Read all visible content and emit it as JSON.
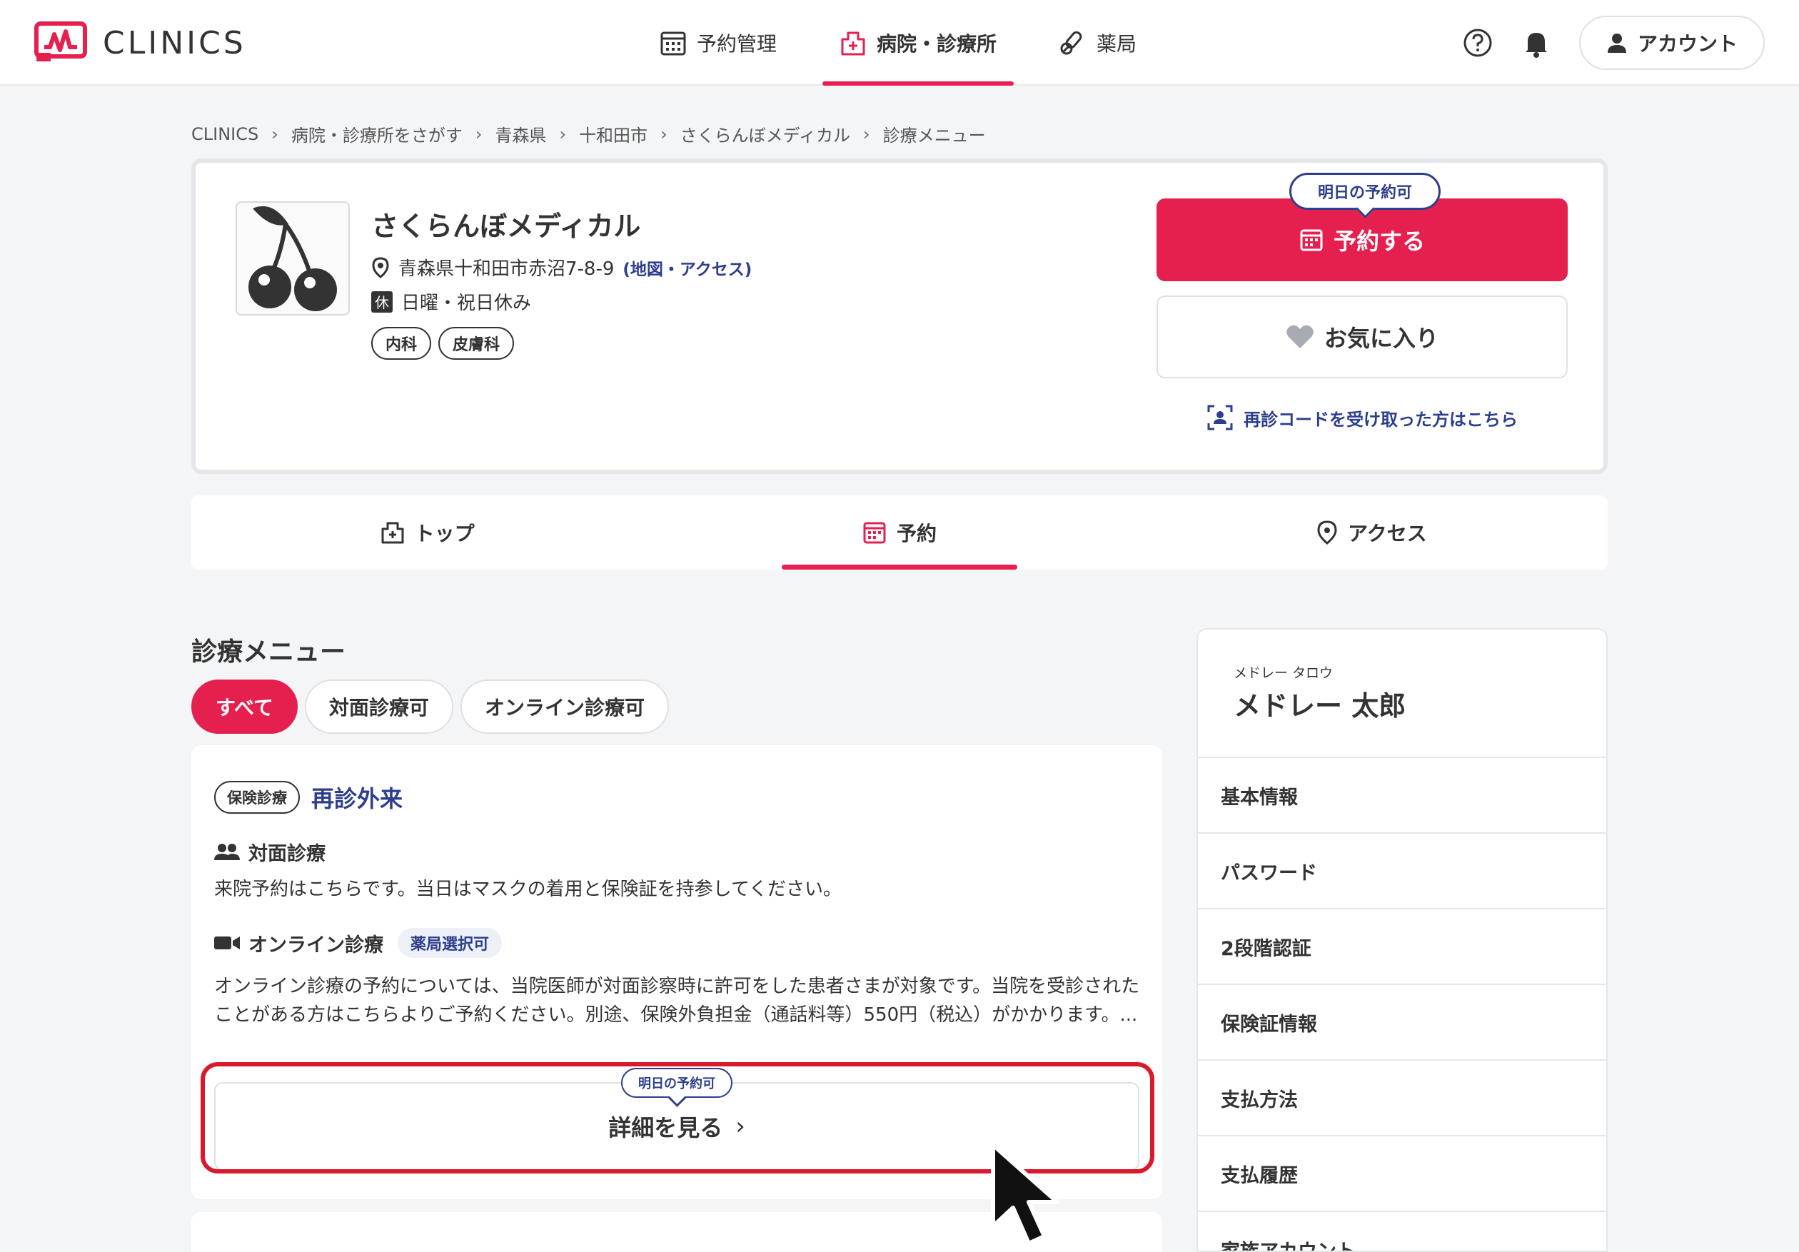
{
  "header": {
    "logo_text": "CLINICS",
    "nav": [
      {
        "label": "予約管理"
      },
      {
        "label": "病院・診療所"
      },
      {
        "label": "薬局"
      }
    ],
    "account_label": "アカウント"
  },
  "breadcrumb": [
    "CLINICS",
    "病院・診療所をさがす",
    "青森県",
    "十和田市",
    "さくらんぼメディカル",
    "診療メニュー"
  ],
  "clinic": {
    "name": "さくらんぼメディカル",
    "address": "青森県十和田市赤沼7-8-9",
    "address_link": "(地図・アクセス)",
    "holiday_badge": "休",
    "holiday": "日曜・祝日休み",
    "tags": [
      "内科",
      "皮膚科"
    ],
    "reserve_tip": "明日の予約可",
    "reserve_label": "予約する",
    "favorite_label": "お気に入り",
    "recode_link": "再診コードを受け取った方はこちら"
  },
  "tabs": [
    {
      "label": "トップ"
    },
    {
      "label": "予約"
    },
    {
      "label": "アクセス"
    }
  ],
  "menu": {
    "title": "診療メニュー",
    "filters": [
      "すべて",
      "対面診療可",
      "オンライン診療可"
    ],
    "card": {
      "badge": "保険診療",
      "title": "再診外来",
      "inperson_label": "対面診療",
      "inperson_text": "来院予約はこちらです。当日はマスクの着用と保険証を持参してください。",
      "online_label": "オンライン診療",
      "online_badge": "薬局選択可",
      "online_text": "オンライン診療の予約については、当院医師が対面診察時に許可をした患者さまが対象です。当院を受診されたことがある方はこちらよりご予約ください。別途、保険外負担金（通話料等）550円（税込）がかかります。...",
      "detail_tip": "明日の予約可",
      "detail_label": "詳細を見る"
    }
  },
  "sidebar": {
    "ruby": "メドレー タロウ",
    "name": "メドレー 太郎",
    "items": [
      "基本情報",
      "パスワード",
      "2段階認証",
      "保険証情報",
      "支払方法",
      "支払履歴",
      "家族アカウント"
    ]
  },
  "colors": {
    "accent": "#e5204f",
    "link": "#2d3e8c",
    "highlight": "#d81a2c"
  }
}
